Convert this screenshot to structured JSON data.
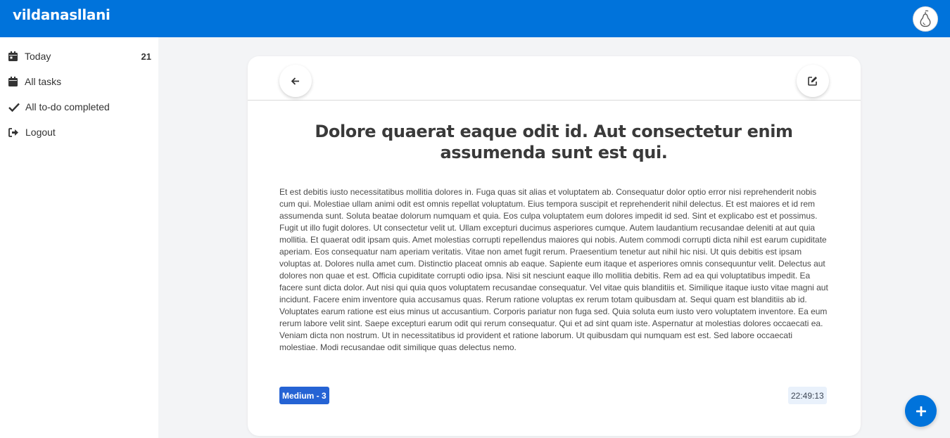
{
  "header": {
    "brand": "vildanasllani",
    "avatar_icon": "pear-icon"
  },
  "sidebar": {
    "items": [
      {
        "label": "Today",
        "count": "21",
        "icon": "calendar-day-icon"
      },
      {
        "label": "All tasks",
        "count": "",
        "icon": "calendar-icon"
      },
      {
        "label": "All to-do completed",
        "count": "",
        "icon": "check-icon"
      },
      {
        "label": "Logout",
        "count": "",
        "icon": "logout-icon"
      }
    ]
  },
  "task": {
    "title": "Dolore quaerat eaque odit id. Aut consectetur enim assumenda sunt est qui.",
    "description": "Et est debitis iusto necessitatibus mollitia dolores in. Fuga quas sit alias et voluptatem ab. Consequatur dolor optio error nisi reprehenderit nobis cum qui. Molestiae ullam animi odit est omnis repellat voluptatum. Eius tempora suscipit et reprehenderit nihil delectus. Et est maiores et id rem assumenda sunt. Soluta beatae dolorum numquam et quia. Eos culpa voluptatem eum dolores impedit id sed. Sint et explicabo est et possimus. Fugit ut illo fugit dolores. Ut consectetur velit ut. Ullam excepturi ducimus asperiores cumque. Autem laudantium recusandae deleniti at aut quia mollitia. Et quaerat odit ipsam quis. Amet molestias corrupti repellendus maiores qui nobis. Autem commodi corrupti dicta nihil est earum cupiditate aperiam. Eos consequatur nam aperiam veritatis. Vitae non amet fugit rerum. Praesentium tenetur aut nihil hic nisi. Ut quis debitis est ipsam voluptas at. Dolores nulla amet cum. Distinctio placeat omnis ab eaque. Sapiente eum itaque et asperiores omnis consequuntur velit. Delectus aut dolores non quae et est. Officia cupiditate corrupti odio ipsa. Nisi sit nesciunt eaque illo mollitia debitis. Rem ad ea qui voluptatibus impedit. Ea facere sunt dicta dolor. Aut nisi qui quia quos voluptatem recusandae consequatur. Vel vitae quis blanditiis et. Similique itaque iusto vitae magni aut incidunt. Facere enim inventore quia accusamus quas. Rerum ratione voluptas ex rerum totam quibusdam at. Sequi quam est blanditiis ab id. Voluptates earum ratione est eius minus ut accusantium. Corporis pariatur non fuga sed. Quia soluta eum iusto vero voluptatem inventore. Ea eum rerum labore velit sint. Saepe excepturi earum odit qui rerum consequatur. Qui et ad sint quam iste. Aspernatur at molestias dolores occaecati ea. Veniam dicta non nostrum. Ut in necessitatibus id provident et ratione laborum. Ut quibusdam qui numquam est est. Sed labore occaecati molestiae. Modi recusandae odit similique quas delectus nemo.",
    "priority": "Medium - 3",
    "time": "22:49:13"
  },
  "icons": {
    "back": "arrow-left-icon",
    "edit": "edit-icon",
    "add": "plus-icon"
  },
  "colors": {
    "primary": "#0073db",
    "badge": "#2563d4",
    "time_bg": "#e9f1fb"
  }
}
